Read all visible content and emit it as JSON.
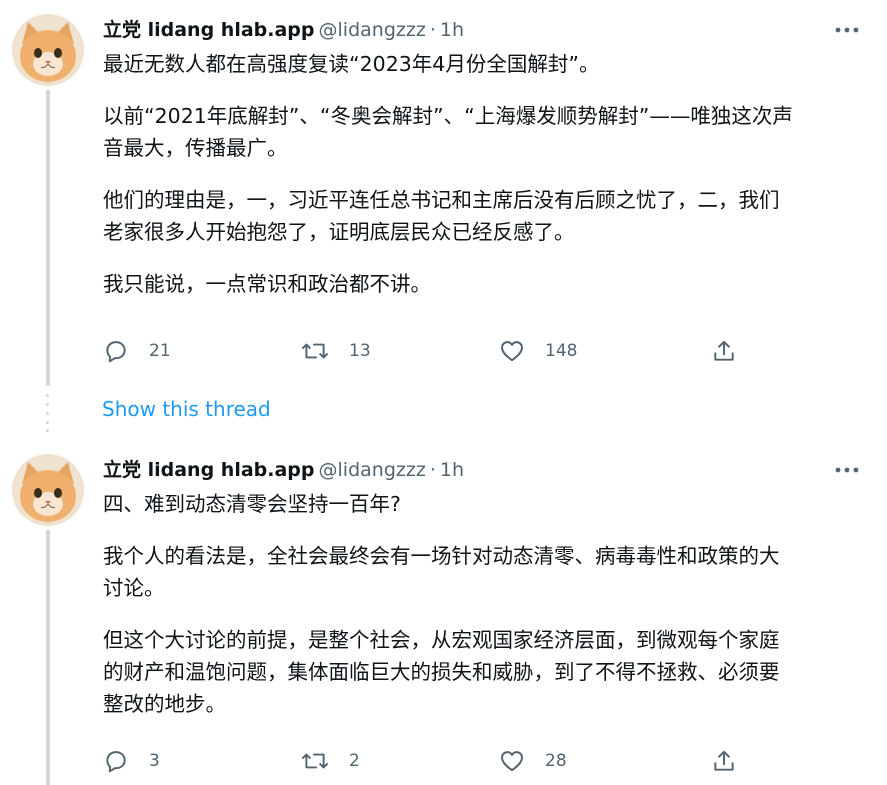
{
  "tweets": [
    {
      "name": "立党 lidang hlab.app",
      "handle": "@lidangzzz",
      "separator": "·",
      "time": "1h",
      "paragraphs": [
        "最近无数人都在高强度复读“2023年4月份全国解封”。",
        "以前“2021年底解封”、“冬奥会解封”、“上海爆发顺势解封”——唯独这次声\n音最大，传播最广。",
        "他们的理由是，一，习近平连任总书记和主席后没有后顾之忧了，二，我们\n老家很多人开始抱怨了，证明底层民众已经反感了。",
        "我只能说，一点常识和政治都不讲。"
      ],
      "reply_count": "21",
      "retweet_count": "13",
      "like_count": "148"
    },
    {
      "name": "立党 lidang hlab.app",
      "handle": "@lidangzzz",
      "separator": "·",
      "time": "1h",
      "paragraphs": [
        "四、难到动态清零会坚持一百年?",
        "我个人的看法是，全社会最终会有一场针对动态清零、病毒毒性和政策的大\n讨论。",
        "但这个大讨论的前提，是整个社会，从宏观国家经济层面，到微观每个家庭\n的财产和温饱问题，集体面临巨大的损失和威胁，到了不得不拯救、必须要\n整改的地步。"
      ],
      "reply_count": "3",
      "retweet_count": "2",
      "like_count": "28"
    }
  ],
  "show_thread_label": "Show this thread",
  "icons": {
    "avatar": "cat-avatar",
    "more": "more-dots-icon",
    "reply": "reply-icon",
    "retweet": "retweet-icon",
    "like": "heart-icon",
    "share": "share-icon"
  },
  "colors": {
    "link": "#1d9bf0",
    "secondary_text": "#536471",
    "thread_line": "#cfd9de",
    "primary_text": "#0f1419"
  }
}
